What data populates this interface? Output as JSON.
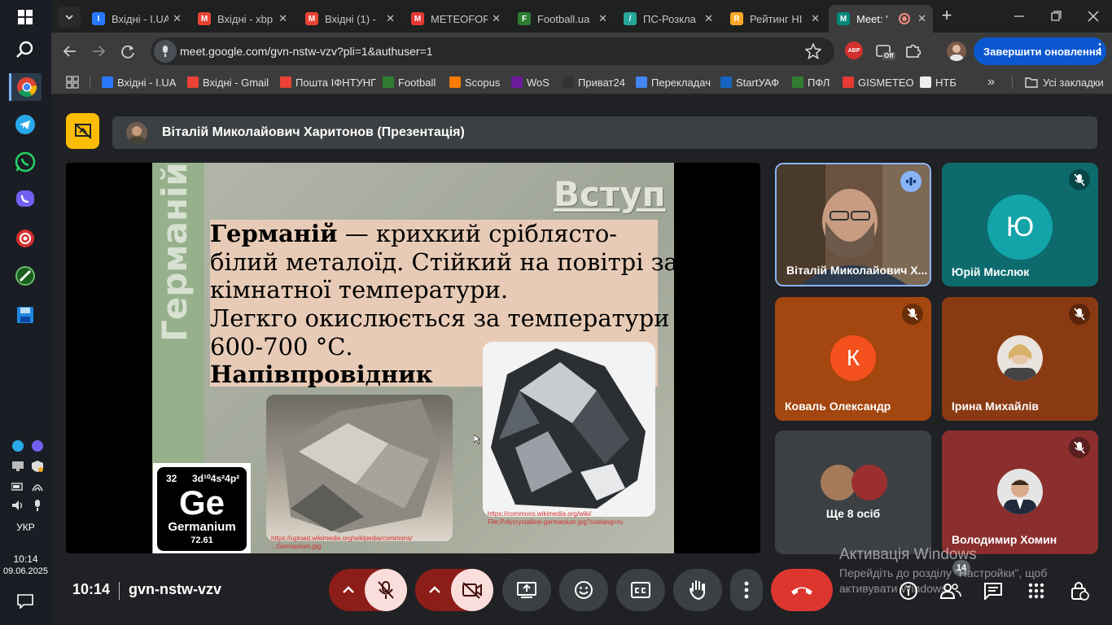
{
  "taskbar": {
    "lang": "УКР",
    "time": "10:14",
    "date": "09.06.2025"
  },
  "tabs": [
    {
      "title": "Вхідні - I.UA",
      "color": "#2979ff",
      "letter": "I"
    },
    {
      "title": "Вхідні - xbp",
      "color": "#ea4335",
      "letter": "M"
    },
    {
      "title": "Вхідні (1) -",
      "color": "#ea4335",
      "letter": "M"
    },
    {
      "title": "METEOFOR",
      "color": "#e53935",
      "letter": "M"
    },
    {
      "title": "Football.ua",
      "color": "#2e7d32",
      "letter": "F"
    },
    {
      "title": "ПС-Розкла",
      "color": "#26a69a",
      "letter": "/"
    },
    {
      "title": "Рейтинг НІ",
      "color": "#f9a825",
      "letter": "R"
    },
    {
      "title": "Meet: '",
      "color": "#00897b",
      "letter": "M"
    }
  ],
  "toolbar": {
    "url": "meet.google.com/gvn-nstw-vzv?pli=1&authuser=1",
    "update_label": "Завершити оновлення",
    "abp": "ABP",
    "off": "Off"
  },
  "bookmarks": [
    {
      "label": "Вхідні - I.UA",
      "color": "#2979ff"
    },
    {
      "label": "Вхідні - Gmail",
      "color": "#ea4335"
    },
    {
      "label": "Пошта ІФНТУНГ",
      "color": "#ea4335"
    },
    {
      "label": "Football",
      "color": "#2e7d32"
    },
    {
      "label": "Scopus",
      "color": "#f57c00"
    },
    {
      "label": "WoS",
      "color": "#6a1b9a"
    },
    {
      "label": "Приват24",
      "color": "#333333"
    },
    {
      "label": "Перекладач",
      "color": "#4285f4"
    },
    {
      "label": "StartУАФ",
      "color": "#1565c0"
    },
    {
      "label": "ПФЛ",
      "color": "#2e7d32"
    },
    {
      "label": "GISMETEO",
      "color": "#e53935"
    },
    {
      "label": "НТБ",
      "color": "#eeeeee"
    }
  ],
  "all_bookmarks": "Усі закладки",
  "meet": {
    "presenter_label": "Віталій Миколайович Харитонов (Презентація)",
    "time": "10:14",
    "meeting_code": "gvn-nstw-vzv",
    "participant_count": "14",
    "windows_activation_title": "Активація Windows",
    "windows_activation_text": "Перейдіть до розділу \"Настройки\", щоб активувати Windows."
  },
  "slide": {
    "vertical_title": "Германій",
    "heading": "Вступ",
    "line1_bold": "Германій",
    "line1_rest": " —  крихкий сріблясто-",
    "line2": "білий металоїд. Стійкий на повітрі за",
    "line3": "кімнатної температури.",
    "line4": "Легкго окислюється за температури",
    "line5": "600-700 °С.",
    "line6": "Напівпровідник",
    "element_number": "32",
    "element_config": "3d¹⁰4s²4p²",
    "element_symbol": "Ge",
    "element_name": "Germanium",
    "element_mass": "72.61",
    "link_right_1": "https://commons.wikimedia.org/wiki/",
    "link_right_2": "File:Polycrystalline-germanium.jpg?uselang=ru",
    "link_left_1": "https://upload.wikimedia.org/wikipedia/commons/",
    "link_left_2": "...Germanium.jpg"
  },
  "participants": [
    {
      "name": "Віталій Миколайович Х...",
      "type": "video"
    },
    {
      "name": "Юрій Мислюк",
      "initial": "Ю",
      "avatar_color": "#12a4a8",
      "bg": "#0d6b6e"
    },
    {
      "name": "Коваль Олександр",
      "initial": "К",
      "avatar_color": "#f4511e",
      "bg": "#a4460f"
    },
    {
      "name": "Ірина Михайлів",
      "bg": "#8a3a12"
    },
    {
      "name": "Ще 8 осіб",
      "bg": "#3c4043"
    },
    {
      "name": "Володимир Хомин",
      "bg": "#8a2e2e"
    }
  ]
}
